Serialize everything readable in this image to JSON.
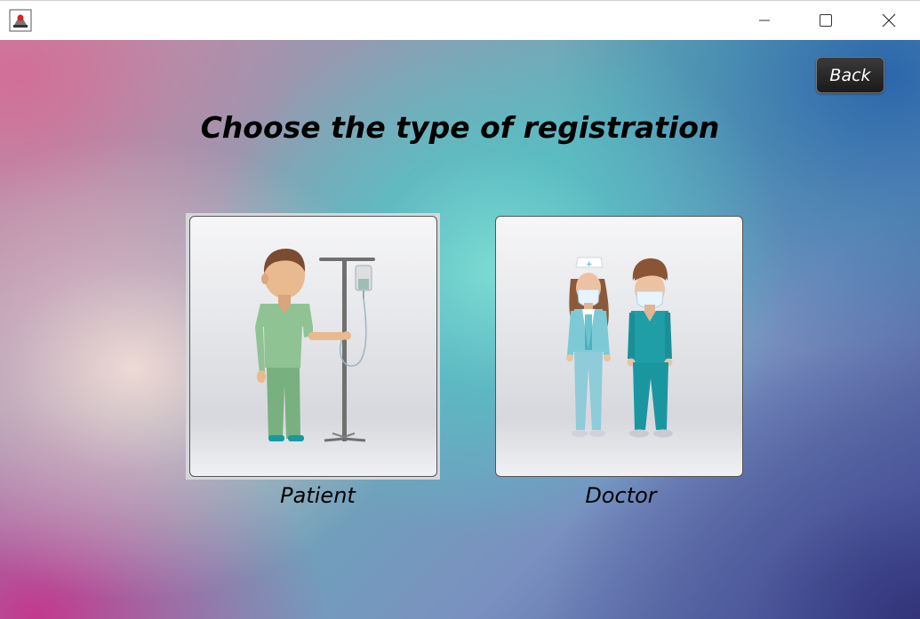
{
  "window": {
    "app_icon": "java-app-icon",
    "controls": [
      "minimize-icon",
      "maximize-icon",
      "close-icon"
    ]
  },
  "header": {
    "back_label": "Back",
    "title": "Choose the type of registration"
  },
  "options": {
    "patient_label": "Patient",
    "doctor_label": "Doctor"
  },
  "colors": {
    "back_button": "#2a2a2a",
    "patient_scrubs": "#8fc394",
    "doctor_scrubs": "#1f9ea8",
    "nurse_uniform": "#7ec9d6"
  }
}
